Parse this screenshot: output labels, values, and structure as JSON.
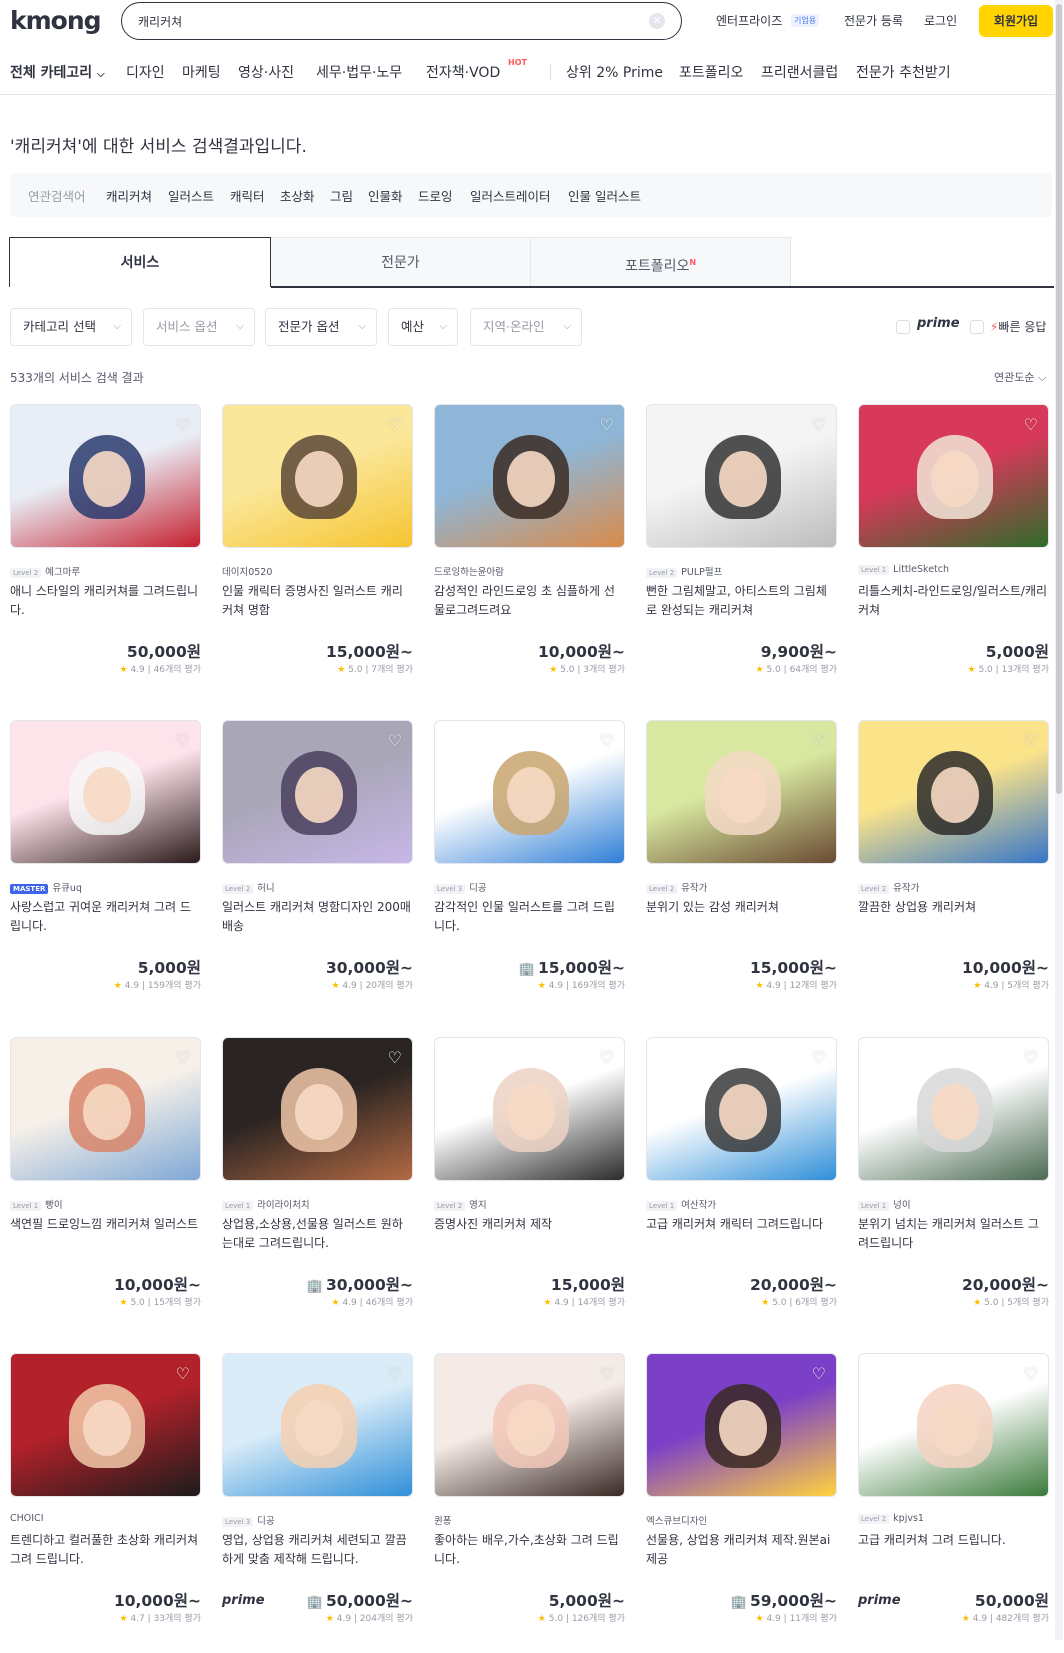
{
  "header": {
    "logo": "kmong",
    "search_value": "캐리커쳐",
    "links": {
      "enterprise": "엔터프라이즈",
      "enterprise_badge": "기업용",
      "expert_register": "전문가 등록",
      "login": "로그인"
    },
    "signup": "회원가입"
  },
  "categories": [
    "전체 카테고리",
    "디자인",
    "마케팅",
    "영상·사진",
    "세무·법무·노무",
    "전자책·VOD",
    "상위 2% Prime",
    "포트폴리오",
    "프리랜서클럽",
    "전문가 추천받기"
  ],
  "hot_badge": "HOT",
  "results_title": "'캐리커쳐'에 대한 서비스 검색결과입니다.",
  "related": {
    "label": "연관검색어",
    "terms": [
      "캐리커쳐",
      "일러스트",
      "캐릭터",
      "초상화",
      "그림",
      "인물화",
      "드로잉",
      "일러스트레이터",
      "인물 일러스트"
    ]
  },
  "tabs": {
    "service": "서비스",
    "expert": "전문가",
    "portfolio": "포트폴리오",
    "portfolio_sup": "N"
  },
  "filters": [
    "카테고리 선택",
    "서비스 옵션",
    "전문가 옵션",
    "예산",
    "지역·온라인"
  ],
  "toggles": {
    "prime": "prime",
    "fast": "빠른 응답"
  },
  "result_count": "533개의 서비스 검색 결과",
  "sort": "연관도순",
  "cards": [
    {
      "level": "Level 2",
      "seller": "예그마루",
      "title": "애니 스타일의 캐리커쳐를 그려드립니다.",
      "price": "50,000원",
      "score": "4.9",
      "reviews": "46개의 평가",
      "badge": "",
      "prime": "",
      "colors": [
        "#e9eef6",
        "#c5202f",
        "#2a3a6e"
      ]
    },
    {
      "level": "",
      "seller": "데이지0520",
      "title": "인물 캐릭터 증명사진 일러스트 캐리커쳐 명함",
      "price": "15,000원~",
      "score": "5.0",
      "reviews": "7개의 평가",
      "badge": "",
      "prime": "",
      "colors": [
        "#fbe79a",
        "#f5c430",
        "#5a4636"
      ]
    },
    {
      "level": "",
      "seller": "드로잉하는윤아람",
      "title": "감성적인 라인드로잉 초 심플하게 선물로그려드려요",
      "price": "10,000원~",
      "score": "5.0",
      "reviews": "3개의 평가",
      "badge": "",
      "prime": "",
      "colors": [
        "#8fb6d6",
        "#d98b4a",
        "#3a2a22"
      ]
    },
    {
      "level": "Level 2",
      "seller": "PULP펄프",
      "title": "뻔한 그림체말고, 아티스트의 그림체로 완성되는 캐리커쳐",
      "price": "9,900원~",
      "score": "5.0",
      "reviews": "64개의 평가",
      "badge": "",
      "prime": "",
      "colors": [
        "#f4f4f4",
        "#bdbdbd",
        "#333333"
      ]
    },
    {
      "level": "Level 1",
      "seller": "LittleSketch",
      "title": "리틀스케치-라인드로잉/일러스트/캐리커쳐",
      "price": "5,000원",
      "score": "5.0",
      "reviews": "13개의 평가",
      "badge": "",
      "prime": "",
      "colors": [
        "#d8385a",
        "#2f6b2a",
        "#f2e6d9"
      ]
    },
    {
      "level": "MASTER",
      "seller": "유큐uq",
      "title": "사랑스럽고 귀여운 캐리커쳐 그려 드립니다.",
      "price": "5,000원",
      "score": "4.9",
      "reviews": "159개의 평가",
      "badge": "",
      "prime": "",
      "colors": [
        "#fde3ea",
        "#2b1a1a",
        "#f7f7f7"
      ]
    },
    {
      "level": "Level 2",
      "seller": "허니",
      "title": "일러스트 캐리커쳐 명함디자인 200매 배송",
      "price": "30,000원~",
      "score": "4.9",
      "reviews": "20개의 평가",
      "badge": "",
      "prime": "",
      "colors": [
        "#a9a6b8",
        "#c7b7e8",
        "#4a3f5e"
      ]
    },
    {
      "level": "Level 3",
      "seller": "디공",
      "title": "감각적인 인물 일러스트를 그려 드립니다.",
      "price": "15,000원~",
      "score": "4.9",
      "reviews": "169개의 평가",
      "badge": "🏢",
      "prime": "",
      "colors": [
        "#ffffff",
        "#2f7fd6",
        "#c9a56e"
      ]
    },
    {
      "level": "Level 2",
      "seller": "유작가",
      "title": "분위기 있는 감성 캐리커쳐",
      "price": "15,000원~",
      "score": "4.9",
      "reviews": "12개의 평가",
      "badge": "",
      "prime": "",
      "colors": [
        "#d8e8a0",
        "#6a4a32",
        "#f3d8c6"
      ]
    },
    {
      "level": "Level 2",
      "seller": "유작가",
      "title": "깔끔한 상업용 캐리커쳐",
      "price": "10,000원~",
      "score": "4.9",
      "reviews": "5개의 평가",
      "badge": "",
      "prime": "",
      "colors": [
        "#fbe38a",
        "#3576c8",
        "#2a2a2a"
      ]
    },
    {
      "level": "Level 1",
      "seller": "빵이",
      "title": "색연필 드로잉느낌 캐리커쳐 일러스트",
      "price": "10,000원~",
      "score": "5.0",
      "reviews": "15개의 평가",
      "badge": "",
      "prime": "",
      "colors": [
        "#f6f0e8",
        "#7fa8d6",
        "#d8856a"
      ]
    },
    {
      "level": "Level 1",
      "seller": "라이라이처치",
      "title": "상업용,소상용,선물용 일러스트 원하는대로 그려드립니다.",
      "price": "30,000원~",
      "score": "4.9",
      "reviews": "46개의 평가",
      "badge": "🏢",
      "prime": "",
      "colors": [
        "#2a2422",
        "#b36a44",
        "#efc7a8"
      ]
    },
    {
      "level": "Level 2",
      "seller": "영지",
      "title": "증명사진 캐리커쳐 제작",
      "price": "15,000원",
      "score": "4.9",
      "reviews": "14개의 평가",
      "badge": "",
      "prime": "",
      "colors": [
        "#ffffff",
        "#2b2b2b",
        "#ecd2c4"
      ]
    },
    {
      "level": "Level 1",
      "seller": "여산작가",
      "title": "고급 캐리커쳐 캐릭터 그려드립니다",
      "price": "20,000원~",
      "score": "5.0",
      "reviews": "6개의 평가",
      "badge": "",
      "prime": "",
      "colors": [
        "#ffffff",
        "#2f8fd8",
        "#3a3a3a"
      ]
    },
    {
      "level": "Level 1",
      "seller": "넝이",
      "title": "분위기 넘치는 캐리커쳐 일러스트 그려드립니다",
      "price": "20,000원~",
      "score": "5.0",
      "reviews": "5개의 평가",
      "badge": "",
      "prime": "",
      "colors": [
        "#ffffff",
        "#4a6a52",
        "#d8d8d8"
      ]
    },
    {
      "level": "",
      "seller": "CHOICI",
      "title": "트렌디하고 컬러풀한 초상화 캐리커쳐 그려 드립니다.",
      "price": "10,000원~",
      "score": "4.7",
      "reviews": "33개의 평가",
      "badge": "",
      "prime": "",
      "colors": [
        "#b3212a",
        "#1c1c1c",
        "#f1c9a8"
      ]
    },
    {
      "level": "Level 3",
      "seller": "디공",
      "title": "영업, 상업용 캐리커쳐 세련되고 깔끔하게 맞춤 제작해 드립니다.",
      "price": "50,000원~",
      "score": "4.9",
      "reviews": "204개의 평가",
      "badge": "🏢",
      "prime": "prime",
      "colors": [
        "#d9ecf8",
        "#2f8fd8",
        "#f6d0b0"
      ]
    },
    {
      "level": "",
      "seller": "퀸퐁",
      "title": "좋아하는 배우,가수,초상화 그려 드립니다.",
      "price": "5,000원~",
      "score": "5.0",
      "reviews": "126개의 평가",
      "badge": "",
      "prime": "",
      "colors": [
        "#f5ebe6",
        "#3a2a26",
        "#f2c8b8"
      ]
    },
    {
      "level": "",
      "seller": "엑스큐브디자인",
      "title": "선물용, 상업용 캐리커쳐 제작.원본ai 제공",
      "price": "59,000원~",
      "score": "4.9",
      "reviews": "11개의 평가",
      "badge": "🏢",
      "prime": "",
      "colors": [
        "#7b3fc8",
        "#ffd23f",
        "#3a2a22"
      ]
    },
    {
      "level": "Level 2",
      "seller": "kpjvs1",
      "title": "고급 캐리커쳐 그려 드립니다.",
      "price": "50,000원",
      "score": "4.9",
      "reviews": "482개의 평가",
      "badge": "",
      "prime": "prime",
      "colors": [
        "#ffffff",
        "#3a7a3a",
        "#f4d2c2"
      ]
    }
  ]
}
